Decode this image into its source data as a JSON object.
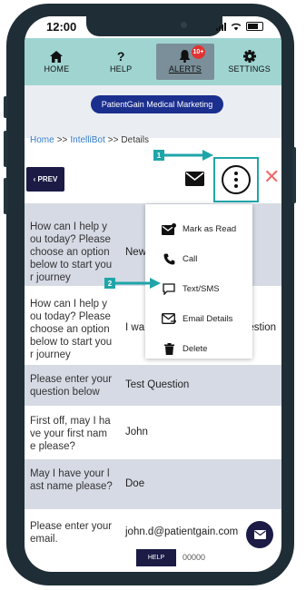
{
  "status_bar": {
    "time": "12:00"
  },
  "nav": {
    "items": [
      {
        "label": "HOME",
        "icon": "home-icon"
      },
      {
        "label": "HELP",
        "icon": "question-icon"
      },
      {
        "label": "ALERTS",
        "icon": "bell-icon",
        "badge": "10+",
        "active": true
      },
      {
        "label": "SETTINGS",
        "icon": "gear-icon"
      }
    ]
  },
  "brand": {
    "label": "PatientGain Medical Marketing"
  },
  "breadcrumb": {
    "home": "Home",
    "sep1": ">>",
    "intellibot": "IntelliBot",
    "sep2": ">>",
    "current": "Details"
  },
  "toolbar": {
    "prev_label": "‹ PREV",
    "close_symbol": "✕"
  },
  "callouts": {
    "one": "1",
    "two": "2"
  },
  "table": {
    "rows": [
      {
        "question": "How can I help y\nou today? Please\nchoose an option\nbelow to start you\nr journey",
        "answer": "New"
      },
      {
        "question": "How can I help y\nou today? Please\nchoose an option\nbelow to start you\nr journey",
        "answer": "I wa",
        "answer_tail": "uestion"
      },
      {
        "question": "Please enter your\nquestion below",
        "answer": "Test Question"
      },
      {
        "question": "First off, may I ha\nve your first nam\ne please?",
        "answer": "John"
      },
      {
        "question": "May I have your l\nast name please?",
        "answer": "Doe"
      },
      {
        "question": "Please enter your\nemail.",
        "answer": "john.d@patientgain.com"
      }
    ]
  },
  "menu": {
    "items": [
      {
        "label": "Mark as Read",
        "icon": "mark-read-icon"
      },
      {
        "label": "Call",
        "icon": "phone-icon"
      },
      {
        "label": "Text/SMS",
        "icon": "chat-icon"
      },
      {
        "label": "Email Details",
        "icon": "email-icon"
      },
      {
        "label": "Delete",
        "icon": "trash-icon"
      }
    ]
  },
  "footer": {
    "help_label": "HELP",
    "number": "00000"
  },
  "colors": {
    "nav_bg": "#9fd4d1",
    "brand": "#1b2f8e",
    "accent": "#1fa5a9",
    "button": "#1b1b46",
    "close": "#ef6b6b"
  }
}
